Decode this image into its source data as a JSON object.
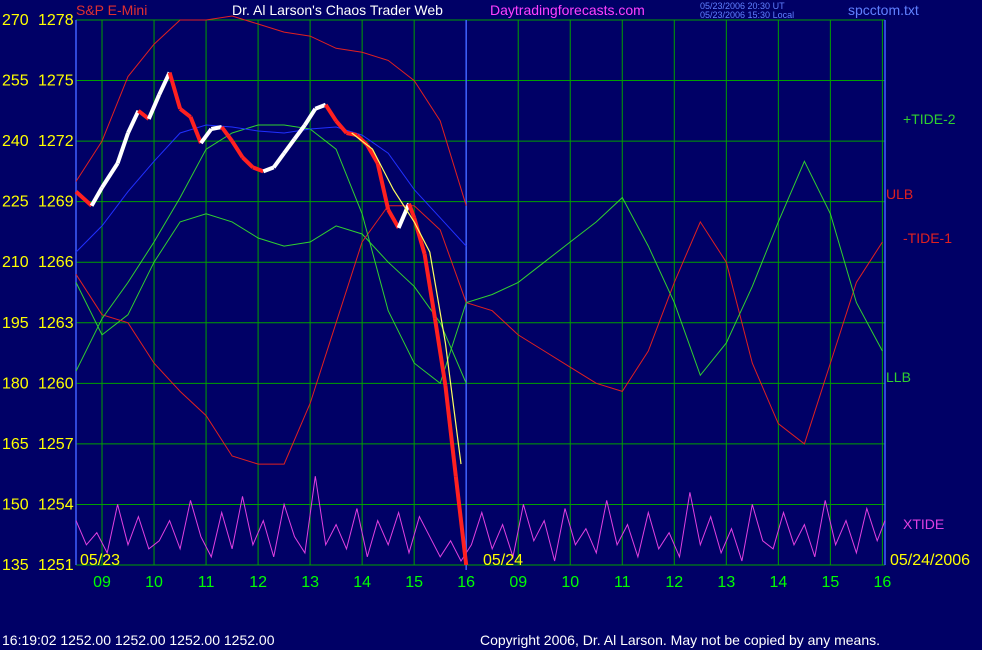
{
  "header": {
    "instrument": "S&P E-Mini",
    "author": "Dr. Al Larson's Chaos Trader Web",
    "site": "Daytradingforecasts.com",
    "timestamp_ut": "05/23/2006 20:30 UT",
    "timestamp_local": "05/23/2006 15:30 Local",
    "filename": "spcctom.txt"
  },
  "footer": {
    "quote": "16:19:02  1252.00  1252.00  1252.00  1252.00",
    "copyright": "Copyright 2006, Dr. Al Larson. May not be copied by any means."
  },
  "colors": {
    "background": "#000066",
    "grid": "#00a000",
    "price_up": "#ffffff",
    "price_down": "#ff2020",
    "tide2": "#30d030",
    "tide1": "#e02020",
    "xtide": "#e040e0",
    "ulb": "#e02020",
    "llb": "#30d030",
    "ma_blue": "#2030ff",
    "ma_yellow": "#ffff60",
    "axis_left": "#ffff00",
    "axis_bottom": "#00ff00",
    "date_text": "#ffff00",
    "vline": "#4060ff"
  },
  "chart_data": {
    "type": "line",
    "title": "S&P E-Mini",
    "y_tide_ticks": [
      "270",
      "255",
      "240",
      "225",
      "210",
      "195",
      "180",
      "165",
      "150",
      "135"
    ],
    "y_price_ticks": [
      "1278",
      "1275",
      "1272",
      "1269",
      "1266",
      "1263",
      "1260",
      "1257",
      "1254",
      "1251"
    ],
    "y_price_range": [
      1251,
      1278
    ],
    "x_hour_ticks": [
      "09",
      "10",
      "11",
      "12",
      "13",
      "14",
      "15",
      "16",
      "09",
      "10",
      "11",
      "12",
      "13",
      "14",
      "15",
      "16"
    ],
    "x_domain": [
      8.5,
      24.05
    ],
    "date_labels": {
      "start": "05/23",
      "mid": "05/24",
      "end": "05/24/2006"
    },
    "series_labels": [
      {
        "key": "tide2",
        "text": "+TIDE-2"
      },
      {
        "key": "ulb",
        "text": "ULB"
      },
      {
        "key": "tide1",
        "text": "-TIDE-1"
      },
      {
        "key": "llb",
        "text": "LLB"
      },
      {
        "key": "xtide",
        "text": "XTIDE"
      }
    ],
    "price_series": {
      "x": [
        8.5,
        8.8,
        9.0,
        9.3,
        9.5,
        9.7,
        9.9,
        10.1,
        10.3,
        10.5,
        10.7,
        10.9,
        11.1,
        11.3,
        11.5,
        11.7,
        11.9,
        12.1,
        12.3,
        12.5,
        12.7,
        12.9,
        13.1,
        13.3,
        13.5,
        13.7,
        13.9,
        14.1,
        14.3,
        14.5,
        14.7,
        14.9,
        15.0,
        15.2,
        15.4,
        15.6,
        15.8,
        16.0
      ],
      "y": [
        1269.5,
        1268.8,
        1269.7,
        1270.9,
        1272.4,
        1273.5,
        1273.1,
        1274.3,
        1275.4,
        1273.6,
        1273.2,
        1271.9,
        1272.6,
        1272.7,
        1272.0,
        1271.2,
        1270.7,
        1270.5,
        1270.7,
        1271.4,
        1272.1,
        1272.8,
        1273.6,
        1273.8,
        1273.0,
        1272.4,
        1272.3,
        1271.8,
        1270.9,
        1268.6,
        1267.7,
        1268.9,
        1268.2,
        1266.4,
        1263.2,
        1259.9,
        1255.4,
        1251.0
      ]
    },
    "tide2": {
      "x": [
        8.5,
        9.0,
        9.5,
        10.0,
        10.5,
        11.0,
        11.5,
        12.0,
        12.5,
        13.0,
        13.5,
        14.0,
        14.5,
        15.0,
        15.5,
        16.0,
        16.5,
        17.0,
        17.5,
        18.0,
        18.5,
        19.0,
        19.5,
        20.0,
        20.5,
        21.0,
        21.5,
        22.0,
        22.5,
        23.0,
        23.5,
        24.0
      ],
      "y": [
        183,
        196,
        205,
        215,
        226,
        238,
        242,
        244,
        244,
        243,
        238,
        222,
        198,
        185,
        180,
        200,
        202,
        205,
        210,
        215,
        220,
        226,
        214,
        200,
        182,
        190,
        204,
        220,
        235,
        222,
        200,
        188
      ]
    },
    "tide1": {
      "x": [
        8.5,
        9.0,
        9.5,
        10.0,
        10.5,
        11.0,
        11.5,
        12.0,
        12.5,
        13.0,
        13.5,
        14.0,
        14.5,
        15.0,
        15.5,
        16.0,
        16.5,
        17.0,
        17.5,
        18.0,
        18.5,
        19.0,
        19.5,
        20.0,
        20.5,
        21.0,
        21.5,
        22.0,
        22.5,
        23.0,
        23.5,
        24.0
      ],
      "y": [
        207,
        197,
        195,
        185,
        178,
        172,
        162,
        160,
        160,
        175,
        195,
        215,
        224,
        224,
        218,
        200,
        198,
        192,
        188,
        184,
        180,
        178,
        188,
        205,
        220,
        210,
        185,
        170,
        165,
        185,
        205,
        215
      ]
    },
    "ulb": {
      "x": [
        8.5,
        9.0,
        9.5,
        10.0,
        10.5,
        11.0,
        11.5,
        12.0,
        12.5,
        13.0,
        13.5,
        14.0,
        14.5,
        15.0,
        15.5,
        16.0
      ],
      "y": [
        230,
        240,
        256,
        264,
        270,
        270,
        271,
        269,
        267,
        266,
        263,
        262,
        260,
        255,
        245,
        224
      ]
    },
    "llb": {
      "x": [
        8.5,
        9.0,
        9.5,
        10.0,
        10.5,
        11.0,
        11.5,
        12.0,
        12.5,
        13.0,
        13.5,
        14.0,
        14.5,
        15.0,
        15.5,
        16.0
      ],
      "y": [
        205,
        192,
        197,
        210,
        220,
        222,
        220,
        216,
        214,
        215,
        219,
        217,
        210,
        204,
        195,
        180
      ]
    },
    "ma_blue": {
      "x": [
        8.5,
        9.0,
        9.5,
        10.0,
        10.5,
        11.0,
        11.5,
        12.0,
        12.5,
        13.0,
        13.5,
        14.0,
        14.5,
        15.0,
        15.5,
        16.0
      ],
      "y": [
        1266.5,
        1267.8,
        1269.5,
        1271.0,
        1272.4,
        1272.8,
        1272.7,
        1272.5,
        1272.4,
        1272.6,
        1272.7,
        1272.3,
        1271.4,
        1269.6,
        1268.2,
        1266.8
      ]
    },
    "ma_yellow": {
      "x": [
        13.8,
        14.2,
        14.6,
        15.0,
        15.3,
        15.6,
        15.9
      ],
      "y": [
        1272.4,
        1271.6,
        1269.6,
        1268.0,
        1266.5,
        1262.0,
        1256.0
      ]
    },
    "xtide": {
      "x": [
        8.5,
        8.7,
        8.9,
        9.1,
        9.3,
        9.5,
        9.7,
        9.9,
        10.1,
        10.3,
        10.5,
        10.7,
        10.9,
        11.1,
        11.3,
        11.5,
        11.7,
        11.9,
        12.1,
        12.3,
        12.5,
        12.7,
        12.9,
        13.1,
        13.3,
        13.5,
        13.7,
        13.9,
        14.1,
        14.3,
        14.5,
        14.7,
        14.9,
        15.1,
        15.3,
        15.5,
        15.7,
        15.9,
        16.1,
        16.3,
        16.5,
        16.7,
        16.9,
        17.1,
        17.3,
        17.5,
        17.7,
        17.9,
        18.1,
        18.3,
        18.5,
        18.7,
        18.9,
        19.1,
        19.3,
        19.5,
        19.7,
        19.9,
        20.1,
        20.3,
        20.5,
        20.7,
        20.9,
        21.1,
        21.3,
        21.5,
        21.7,
        21.9,
        22.1,
        22.3,
        22.5,
        22.7,
        22.9,
        23.1,
        23.3,
        23.5,
        23.7,
        23.9,
        24.05
      ],
      "y": [
        146,
        140,
        143,
        138,
        150,
        140,
        147,
        139,
        141,
        146,
        139,
        151,
        142,
        137,
        148,
        139,
        152,
        140,
        146,
        137,
        150,
        142,
        138,
        157,
        140,
        145,
        139,
        149,
        137,
        146,
        140,
        148,
        138,
        147,
        142,
        137,
        141,
        136,
        140,
        148,
        139,
        145,
        137,
        150,
        141,
        146,
        136,
        149,
        140,
        144,
        138,
        151,
        140,
        145,
        137,
        148,
        139,
        143,
        137,
        153,
        140,
        147,
        138,
        144,
        136,
        150,
        141,
        139,
        148,
        140,
        145,
        137,
        151,
        140,
        146,
        138,
        149,
        141,
        146
      ]
    }
  }
}
